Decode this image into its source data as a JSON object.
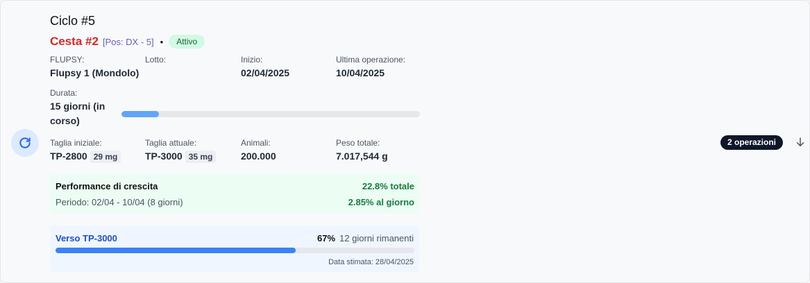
{
  "cycle": {
    "title": "Ciclo #5"
  },
  "basket": {
    "name": "Cesta #2",
    "position": "[Pos: DX - 5]",
    "separator": "•",
    "status": "Attivo"
  },
  "info": {
    "flupsy": {
      "label": "FLUPSY:",
      "value": "Flupsy 1 (Mondolo)"
    },
    "lotto": {
      "label": "Lotto:",
      "value": ""
    },
    "inizio": {
      "label": "Inizio:",
      "value": "02/04/2025"
    },
    "ultima": {
      "label": "Ultima operazione:",
      "value": "10/04/2025"
    }
  },
  "duration": {
    "label": "Durata:",
    "value": "15 giorni (in corso)",
    "progress": 0.125
  },
  "stats": {
    "taglia_iniziale": {
      "label": "Taglia iniziale:",
      "value": "TP-2800",
      "chip": "29 mg"
    },
    "taglia_attuale": {
      "label": "Taglia attuale:",
      "value": "TP-3000",
      "chip": "35 mg"
    },
    "animali": {
      "label": "Animali:",
      "value": "200.000"
    },
    "peso": {
      "label": "Peso totale:",
      "value": "7.017,544 g"
    }
  },
  "performance": {
    "title": "Performance di crescita",
    "total": "22.8% totale",
    "period": "Periodo: 02/04 - 10/04 (8 giorni)",
    "per_day": "2.85% al giorno"
  },
  "target": {
    "label": "Verso TP-3000",
    "percent": "67%",
    "remaining": "12 giorni rimanenti",
    "progress": 0.67,
    "estimated": "Data stimata: 28/04/2025"
  },
  "operations": {
    "badge": "2 operazioni"
  },
  "icons": {
    "refresh": "refresh-icon",
    "expand": "arrow-down-icon"
  },
  "colors": {
    "basket": "#dc2626",
    "active_badge_bg": "#d1fae5",
    "perf_bg": "#ecfdf3",
    "target_fill": "#3b82f6",
    "accent": "#2563eb"
  }
}
